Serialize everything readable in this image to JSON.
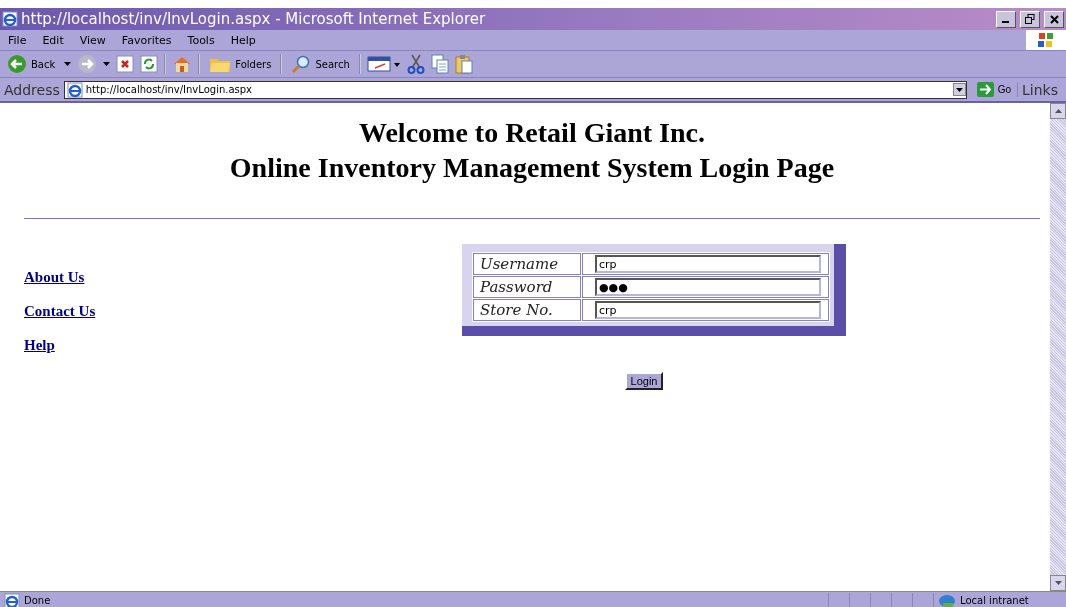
{
  "window": {
    "title": "http://localhost/inv/InvLogin.aspx - Microsoft Internet Explorer"
  },
  "menu": [
    "File",
    "Edit",
    "View",
    "Favorites",
    "Tools",
    "Help"
  ],
  "toolbar": [
    {
      "kind": "back",
      "label": "Back"
    },
    {
      "kind": "forward"
    },
    {
      "kind": "stop"
    },
    {
      "kind": "refresh"
    },
    {
      "kind": "home"
    },
    {
      "kind": "folders",
      "label": "Folders"
    },
    {
      "kind": "search",
      "label": "Search"
    },
    {
      "kind": "edit"
    },
    {
      "kind": "cut"
    },
    {
      "kind": "copy"
    },
    {
      "kind": "paste"
    }
  ],
  "address": {
    "label": "Address",
    "value": "http://localhost/inv/InvLogin.aspx",
    "go": "Go",
    "links": "Links"
  },
  "page": {
    "heading": [
      "Welcome to Retail Giant Inc.",
      "Online Inventory Management System Login Page"
    ],
    "links": [
      "About Us",
      "Contact Us",
      "Help"
    ],
    "form": [
      {
        "label": "Username",
        "value": "crp"
      },
      {
        "label": "Password",
        "value": "●●●"
      },
      {
        "label": "Store No.",
        "value": "crp"
      }
    ],
    "button": "Login"
  },
  "status_bar": {
    "text": "Done",
    "zone": "Local intranet"
  }
}
